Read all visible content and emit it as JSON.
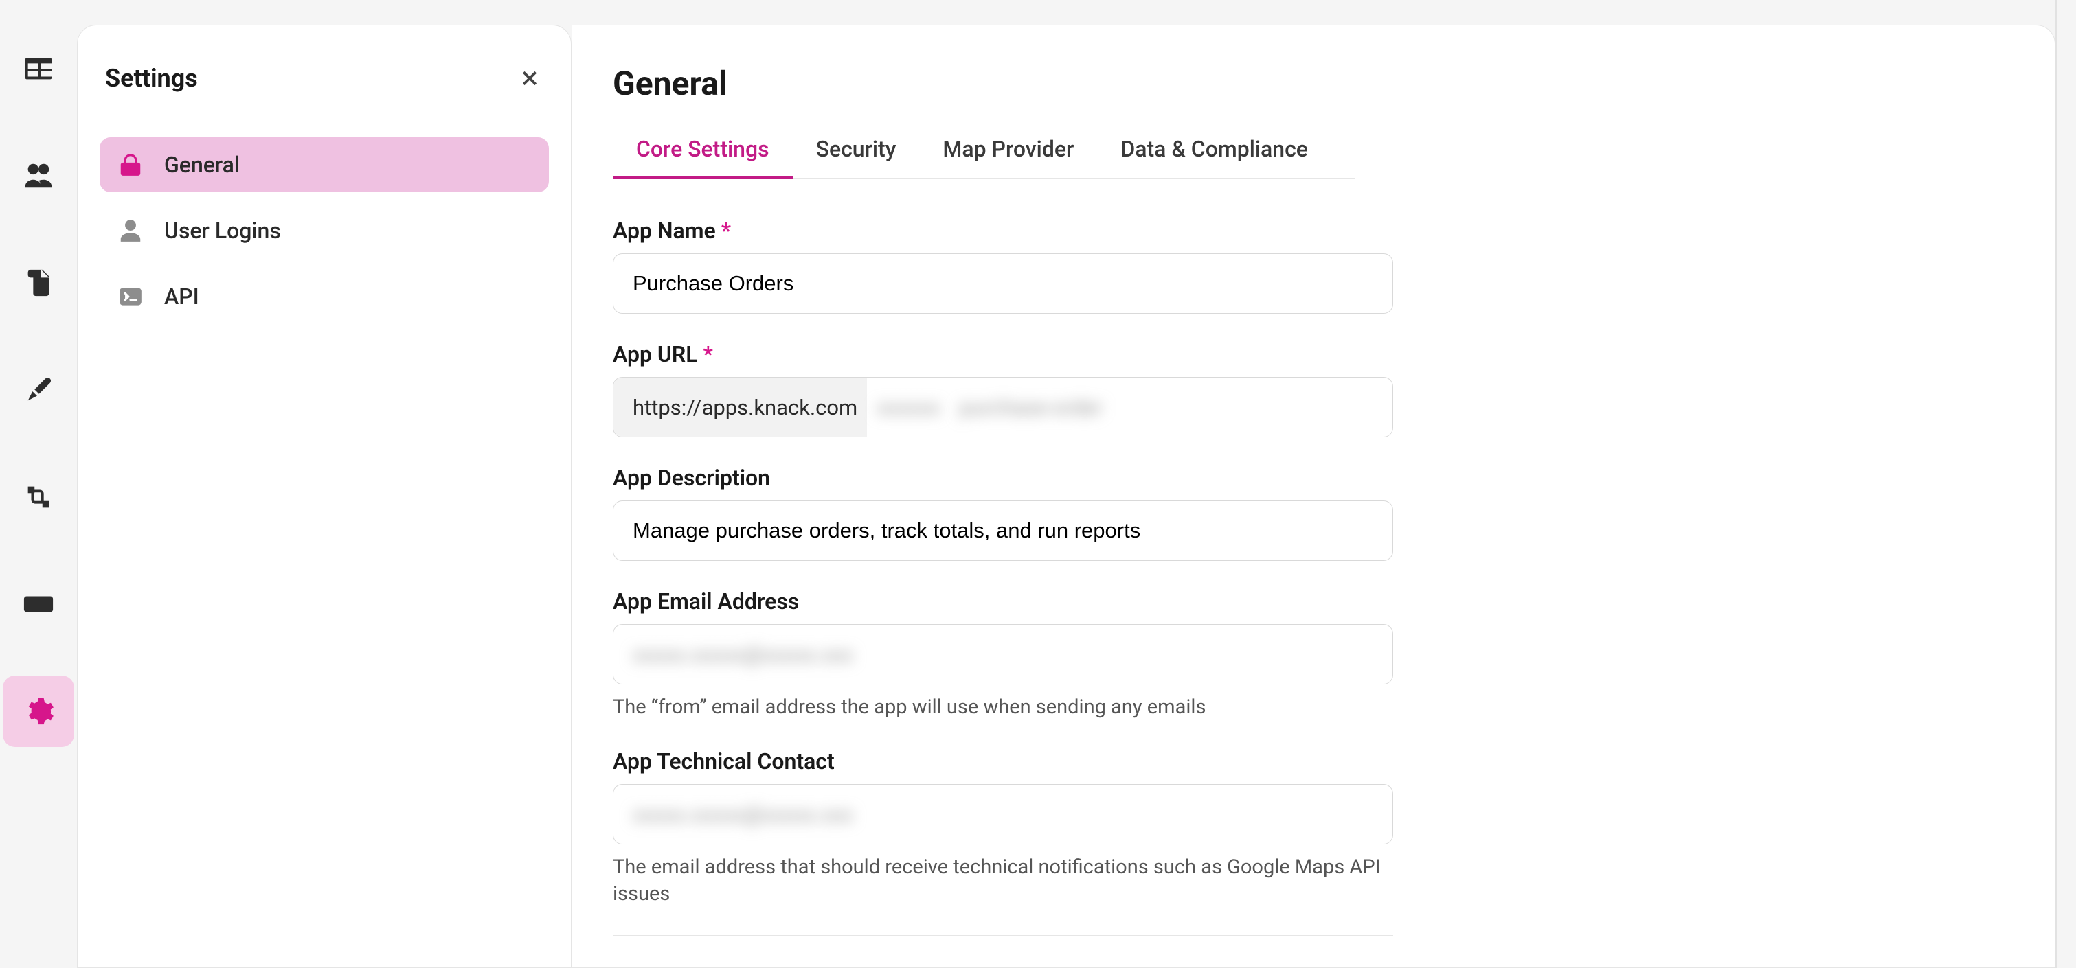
{
  "panel": {
    "title": "Settings",
    "items": [
      {
        "id": "general",
        "label": "General"
      },
      {
        "id": "user-logins",
        "label": "User Logins"
      },
      {
        "id": "api",
        "label": "API"
      }
    ]
  },
  "main": {
    "heading": "General",
    "tabs": [
      {
        "id": "core",
        "label": "Core Settings"
      },
      {
        "id": "sec",
        "label": "Security"
      },
      {
        "id": "map",
        "label": "Map Provider"
      },
      {
        "id": "data",
        "label": "Data & Compliance"
      }
    ],
    "fields": {
      "app_name": {
        "label": "App Name",
        "required": true,
        "value": "Purchase Orders"
      },
      "app_url": {
        "label": "App URL",
        "required": true,
        "prefix": "https://apps.knack.com",
        "seg1": "xxxxxx",
        "seg2": "purchase-order"
      },
      "app_desc": {
        "label": "App Description",
        "value": "Manage purchase orders, track totals, and run reports"
      },
      "app_email": {
        "label": "App Email Address",
        "value": "xxxxx.xxxxx@xxxxx.xxx",
        "help": "The “from” email address the app will use when sending any emails"
      },
      "app_tech": {
        "label": "App Technical Contact",
        "value": "xxxxx.xxxxx@xxxxx.xxx",
        "help": "The email address that should receive technical notifications such as Google Maps API issues"
      }
    },
    "required_mark": "*"
  }
}
